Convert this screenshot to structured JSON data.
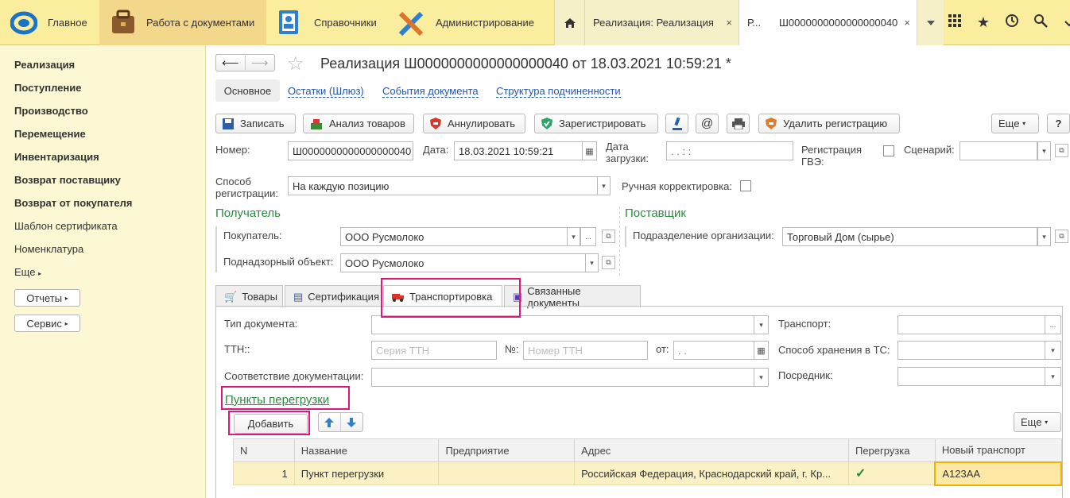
{
  "topbar": {
    "sections": [
      {
        "label": "Главное",
        "icon": "app-logo-icon"
      },
      {
        "label": "Работа с документами",
        "icon": "briefcase-icon"
      },
      {
        "label": "Справочники",
        "icon": "address-book-icon"
      },
      {
        "label": "Администрирование",
        "icon": "tools-icon"
      }
    ],
    "tabs": [
      {
        "label": "Реализация: Реализация",
        "close": "×"
      },
      {
        "label_short": "Р...",
        "label": "Ш0000000000000000040",
        "close": "×"
      }
    ],
    "icons": [
      "grid-icon",
      "star-icon",
      "history-icon",
      "search-icon",
      "chevron-down-icon"
    ]
  },
  "sidebar": {
    "items": [
      "Реализация",
      "Поступление",
      "Производство",
      "Перемещение",
      "Инвентаризация",
      "Возврат поставщику",
      "Возврат от покупателя",
      "Шаблон сертификата",
      "Номенклатура",
      "Еще"
    ],
    "buttons": [
      "Отчеты",
      "Сервис"
    ]
  },
  "doc": {
    "title": "Реализация Ш0000000000000000040 от 18.03.2021 10:59:21 *",
    "navtabs": [
      "Основное",
      "Остатки (Шлюз)",
      "События документа",
      "Структура подчиненности"
    ],
    "toolbar": [
      "Записать",
      "Анализ товаров",
      "Аннулировать",
      "Зарегистрировать",
      "Удалить регистрацию",
      "Еще",
      "?"
    ],
    "fields": {
      "nomer_label": "Номер:",
      "nomer_value": "Ш0000000000000000040",
      "data_label": "Дата:",
      "data_value": "18.03.2021 10:59:21",
      "data_zagruzki_label": "Дата загрузки:",
      "data_zagruzki_value": ". .   : :",
      "gve_label": "Регистрация ГВЭ:",
      "scenario_label": "Сценарий:",
      "sposob_label": "Способ регистрации:",
      "sposob_value": "На каждую позицию",
      "ruchnaya_label": "Ручная корректировка:"
    },
    "recipient": {
      "title": "Получатель",
      "pokupatel_label": "Покупатель:",
      "pokupatel_value": "ООО Русмолоко",
      "object_label": "Поднадзорный объект:",
      "object_value": "ООО Русмолоко"
    },
    "supplier": {
      "title": "Поставщик",
      "podr_label": "Подразделение организации:",
      "podr_value": "Торговый Дом (сырье)"
    },
    "tabs": [
      "Товары",
      "Сертификация",
      "Транспортировка",
      "Связанные документы"
    ],
    "transport": {
      "tip_label": "Тип документа:",
      "ttn_label": "ТТН::",
      "seria_ph": "Серия ТТН",
      "nomer_label": "№:",
      "nomer_ph": "Номер ТТН",
      "ot_label": "от:",
      "ot_value": ". .",
      "sootv_label": "Соответствие документации:",
      "transport_label": "Транспорт:",
      "hranenie_label": "Способ хранения в ТС:",
      "posrednik_label": "Посредник:",
      "points_title": "Пункты перегрузки",
      "add_label": "Добавить",
      "more_label": "Еще"
    },
    "grid": {
      "columns": [
        "N",
        "Название",
        "Предприятие",
        "Адрес",
        "Перегрузка",
        "Новый транспорт"
      ],
      "rows": [
        {
          "n": "1",
          "name": "Пункт перегрузки",
          "company": "",
          "address": "Российская Федерация, Краснодарский край, г. Кр...",
          "reload": "✓",
          "transport": "А123АА"
        }
      ]
    }
  }
}
